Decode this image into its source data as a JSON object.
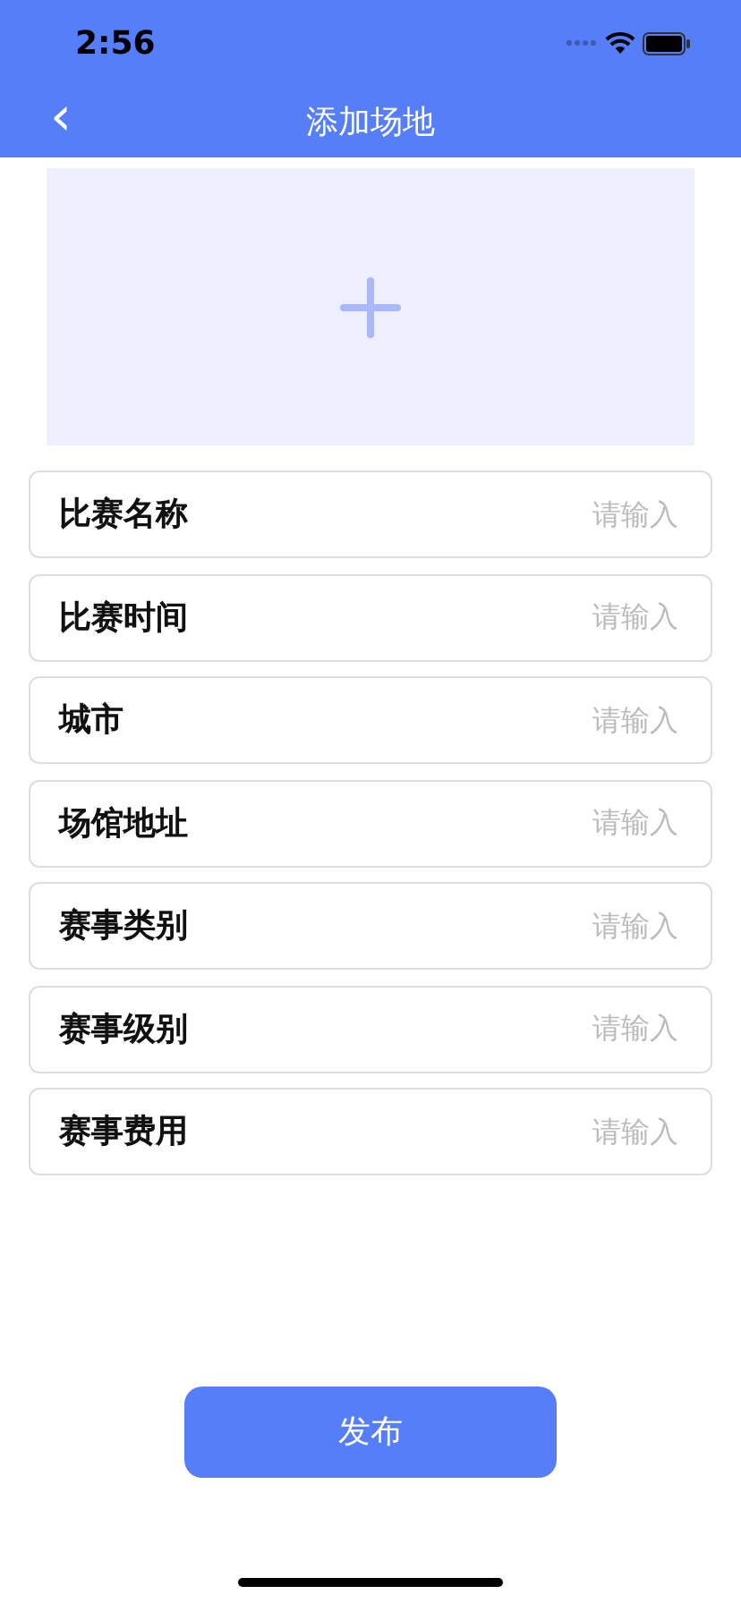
{
  "status_bar": {
    "time": "2:56"
  },
  "nav_bar": {
    "back": "‹",
    "title": "添加场地"
  },
  "upload": {
    "kind": "add-photo"
  },
  "fields": [
    {
      "label": "比赛名称",
      "placeholder": "请输入"
    },
    {
      "label": "比赛时间",
      "placeholder": "请输入"
    },
    {
      "label": "城市",
      "placeholder": "请输入"
    },
    {
      "label": "场馆地址",
      "placeholder": "请输入"
    },
    {
      "label": "赛事类别",
      "placeholder": "请输入"
    },
    {
      "label": "赛事级别",
      "placeholder": "请输入"
    },
    {
      "label": "赛事费用",
      "placeholder": "请输入"
    }
  ],
  "submit_button": "发布"
}
